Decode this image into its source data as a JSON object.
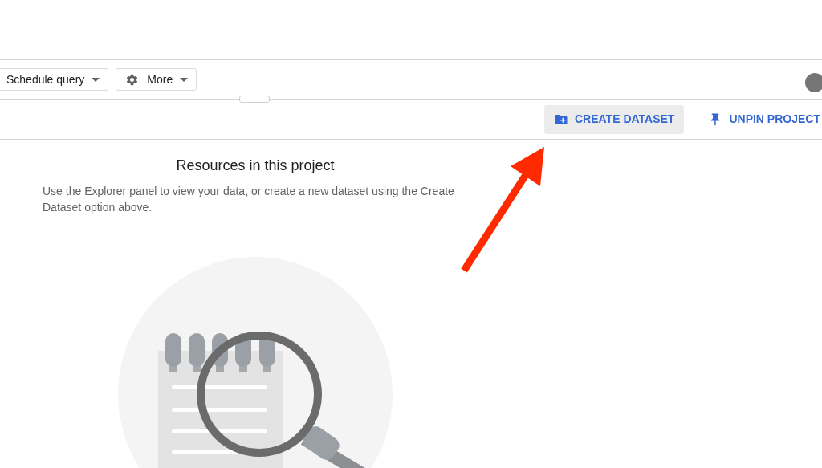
{
  "toolbar": {
    "buttons": [
      {
        "label": "Schedule query",
        "kind": "dropdown"
      },
      {
        "label": "More",
        "kind": "settings-dropdown"
      }
    ]
  },
  "action_bar": {
    "buttons": [
      {
        "label": "CREATE DATASET",
        "kind": "create",
        "hovered": true
      },
      {
        "label": "UNPIN PROJECT",
        "kind": "unpin",
        "hovered": false
      }
    ]
  },
  "content": {
    "heading": "Resources in this project",
    "description": "Use the Explorer panel to view your data, or create a new dataset using the Create Dataset option above."
  }
}
